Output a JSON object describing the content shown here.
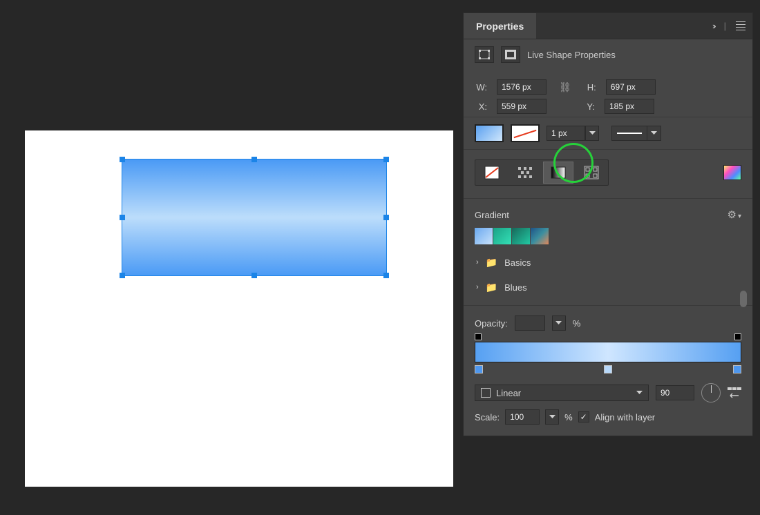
{
  "panel": {
    "title": "Properties"
  },
  "header": {
    "subtitle": "Live Shape Properties"
  },
  "dims": {
    "w_label": "W:",
    "w_value": "1576 px",
    "h_label": "H:",
    "h_value": "697 px",
    "x_label": "X:",
    "x_value": "559 px",
    "y_label": "Y:",
    "y_value": "185 px"
  },
  "stroke": {
    "width": "1 px"
  },
  "gradient": {
    "section_label": "Gradient",
    "folders": [
      "Basics",
      "Blues"
    ]
  },
  "opacity": {
    "label": "Opacity:",
    "value": "",
    "unit": "%"
  },
  "grad_type": {
    "label": "Linear",
    "angle": "90"
  },
  "scale": {
    "label": "Scale:",
    "value": "100",
    "unit": "%",
    "align_label": "Align with layer",
    "align_checked": true
  }
}
